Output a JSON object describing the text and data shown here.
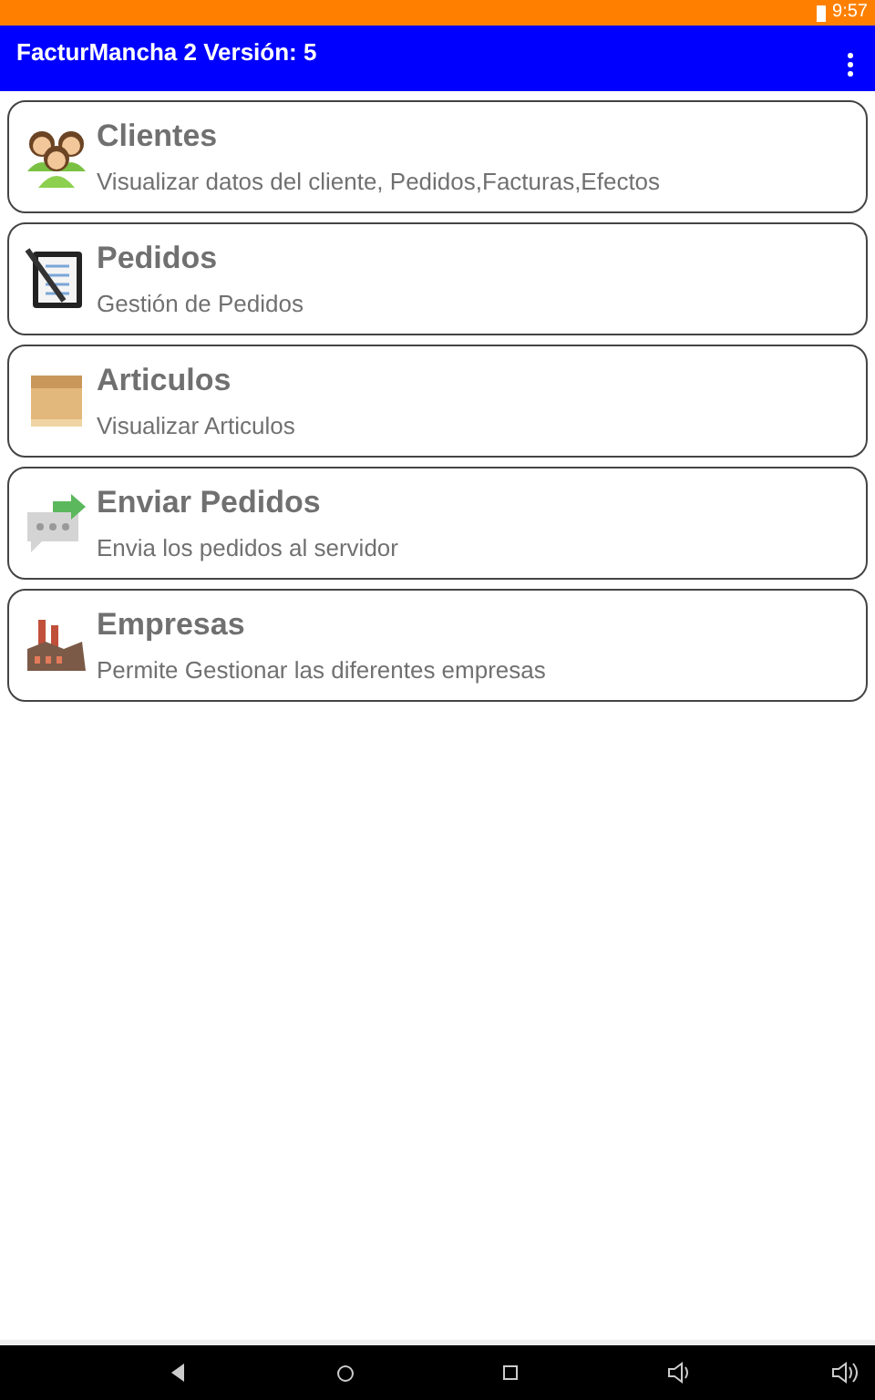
{
  "status_bar": {
    "time": "9:57"
  },
  "app_bar": {
    "title": "FacturMancha 2 Versión: 5"
  },
  "menu": [
    {
      "kind": "people",
      "title": "Clientes",
      "subtitle": "Visualizar datos del cliente, Pedidos,Facturas,Efectos"
    },
    {
      "kind": "clipboard",
      "title": "Pedidos",
      "subtitle": "Gestión de Pedidos"
    },
    {
      "kind": "box",
      "title": "Articulos",
      "subtitle": "Visualizar Articulos"
    },
    {
      "kind": "send",
      "title": "Enviar Pedidos",
      "subtitle": "Envia los pedidos al servidor"
    },
    {
      "kind": "factory",
      "title": "Empresas",
      "subtitle": "Permite Gestionar las diferentes empresas"
    }
  ]
}
